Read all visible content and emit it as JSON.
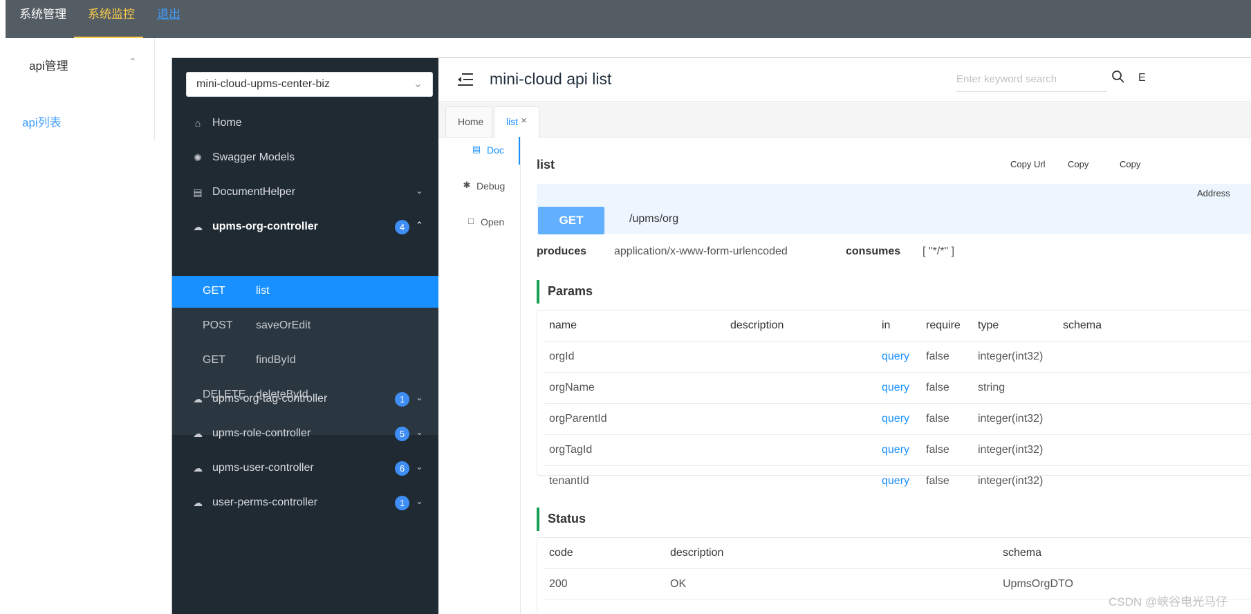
{
  "topnav": {
    "items": [
      "系统管理",
      "系统监控",
      "退出"
    ]
  },
  "outer_sidebar": {
    "group": "api管理",
    "item": "api列表"
  },
  "knife4j": {
    "group_select": "mini-cloud-upms-center-biz",
    "menu": [
      {
        "label": "Home",
        "icon": "home-icon"
      },
      {
        "label": "Swagger Models",
        "icon": "models-icon"
      },
      {
        "label": "DocumentHelper",
        "icon": "document-icon"
      },
      {
        "label": "upms-org-controller",
        "icon": "cloud-icon",
        "badge": "4",
        "expanded": true
      },
      {
        "label": "upms-org-tag-controller",
        "icon": "cloud-icon",
        "badge": "1"
      },
      {
        "label": "upms-role-controller",
        "icon": "cloud-icon",
        "badge": "5"
      },
      {
        "label": "upms-user-controller",
        "icon": "cloud-icon",
        "badge": "6"
      },
      {
        "label": "user-perms-controller",
        "icon": "cloud-icon",
        "badge": "1"
      }
    ],
    "apis": [
      {
        "method": "GET",
        "name": "list",
        "active": true
      },
      {
        "method": "POST",
        "name": "saveOrEdit"
      },
      {
        "method": "GET",
        "name": "findById"
      },
      {
        "method": "DELETE",
        "name": "deleteById"
      }
    ],
    "header_title": "mini-cloud api list",
    "search_placeholder": "Enter keyword search",
    "header_e": "E",
    "tabs": [
      "Home",
      "list"
    ],
    "vtabs": [
      "Doc",
      "Debug",
      "Open"
    ],
    "doc": {
      "title": "list",
      "copy_buttons": [
        "Copy Url",
        "Copy",
        "Copy"
      ],
      "address": "Address",
      "method": "GET",
      "path": "/upms/org",
      "produces_label": "produces",
      "produces": "application/x-www-form-urlencoded",
      "consumes_label": "consumes",
      "consumes": "[ \"*/*\" ]",
      "params_title": "Params",
      "params_headers": [
        "name",
        "description",
        "in",
        "require",
        "type",
        "schema"
      ],
      "params": [
        {
          "name": "orgId",
          "description": "",
          "in": "query",
          "require": "false",
          "type": "integer(int32)",
          "schema": ""
        },
        {
          "name": "orgName",
          "description": "",
          "in": "query",
          "require": "false",
          "type": "string",
          "schema": ""
        },
        {
          "name": "orgParentId",
          "description": "",
          "in": "query",
          "require": "false",
          "type": "integer(int32)",
          "schema": ""
        },
        {
          "name": "orgTagId",
          "description": "",
          "in": "query",
          "require": "false",
          "type": "integer(int32)",
          "schema": ""
        },
        {
          "name": "tenantId",
          "description": "",
          "in": "query",
          "require": "false",
          "type": "integer(int32)",
          "schema": ""
        }
      ],
      "status_title": "Status",
      "status_headers": [
        "code",
        "description",
        "schema"
      ],
      "status": [
        {
          "code": "200",
          "description": "OK",
          "schema": "UpmsOrgDTO"
        }
      ]
    }
  },
  "watermark": "CSDN @峡谷电光马仔",
  "colors": {
    "topbar": "#545c64",
    "active_nav": "#ffd04b",
    "sidebar_dark": "#1f2a33",
    "active_api": "#1890ff",
    "get_method": "#61affe",
    "section_accent": "#18a058"
  }
}
